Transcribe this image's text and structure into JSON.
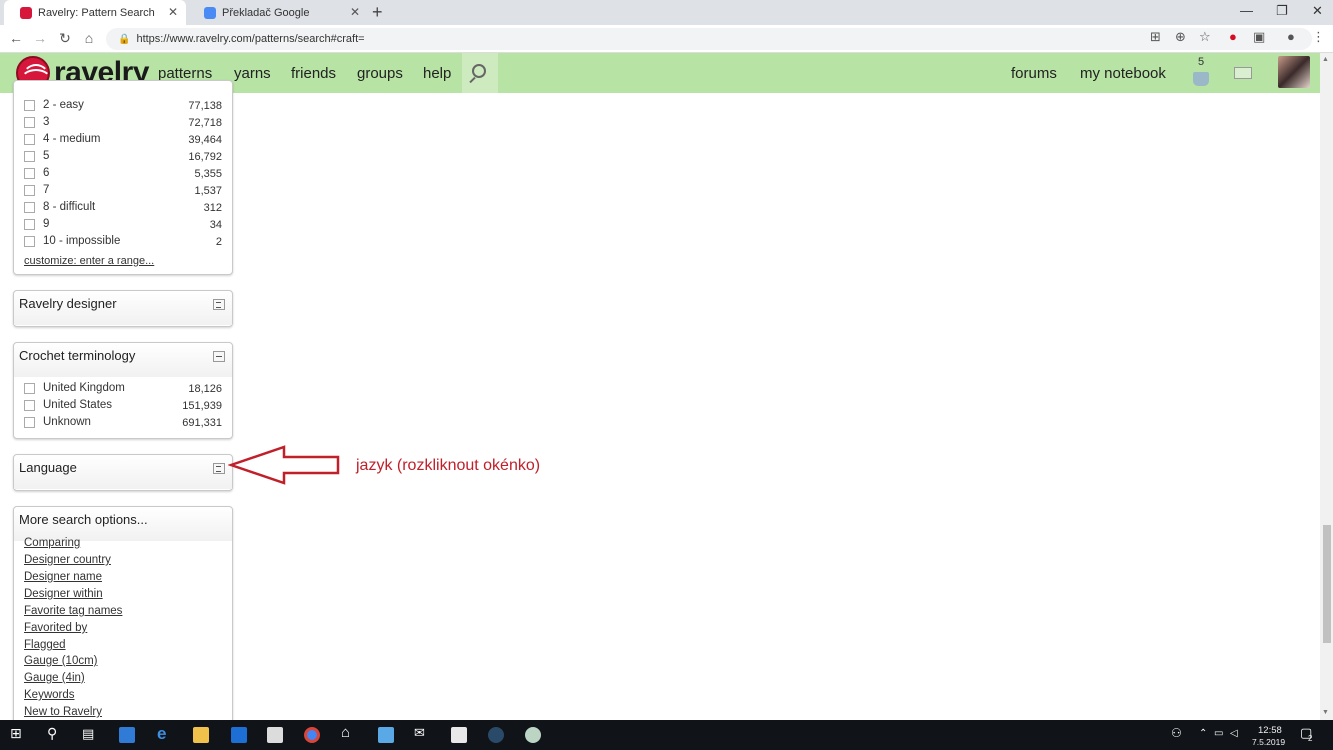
{
  "browser": {
    "tabs": [
      {
        "title": "Ravelry: Pattern Search",
        "active": true
      },
      {
        "title": "Překladač Google",
        "active": false
      }
    ],
    "new_tab_label": "+",
    "url": "https://www.ravelry.com/patterns/search#craft="
  },
  "header": {
    "logo_text": "ravelry",
    "nav": [
      "patterns",
      "yarns",
      "friends",
      "groups",
      "help"
    ],
    "right_nav": [
      "forums",
      "my notebook"
    ],
    "basket_count": "5"
  },
  "difficulty": {
    "rows": [
      {
        "label": "2 - easy",
        "count": "77,138"
      },
      {
        "label": "3",
        "count": "72,718"
      },
      {
        "label": "4 - medium",
        "count": "39,464"
      },
      {
        "label": "5",
        "count": "16,792"
      },
      {
        "label": "6",
        "count": "5,355"
      },
      {
        "label": "7",
        "count": "1,537"
      },
      {
        "label": "8 - difficult",
        "count": "312"
      },
      {
        "label": "9",
        "count": "34"
      },
      {
        "label": "10 - impossible",
        "count": "2"
      }
    ],
    "customize_link": "customize: enter a range..."
  },
  "ravelry_designer": {
    "title": "Ravelry designer"
  },
  "crochet_terminology": {
    "title": "Crochet terminology",
    "rows": [
      {
        "label": "United Kingdom",
        "count": "18,126"
      },
      {
        "label": "United States",
        "count": "151,939"
      },
      {
        "label": "Unknown",
        "count": "691,331"
      }
    ]
  },
  "language": {
    "title": "Language"
  },
  "annotation": {
    "text": "jazyk (rozkliknout okénko)",
    "color": "#c0202a"
  },
  "more_options": {
    "title": "More search options...",
    "links": [
      "Comparing",
      "Designer country",
      "Designer name",
      "Designer within",
      "Favorite tag names",
      "Favorited by",
      "Flagged",
      "Gauge (10cm)",
      "Gauge (4in)",
      "Keywords",
      "New to Ravelry"
    ]
  },
  "taskbar": {
    "time": "12:58",
    "date": "7.5.2019",
    "notification_count": "2"
  },
  "colors": {
    "header_green": "#b7e3a5",
    "ravelry_red": "#d6163a"
  }
}
